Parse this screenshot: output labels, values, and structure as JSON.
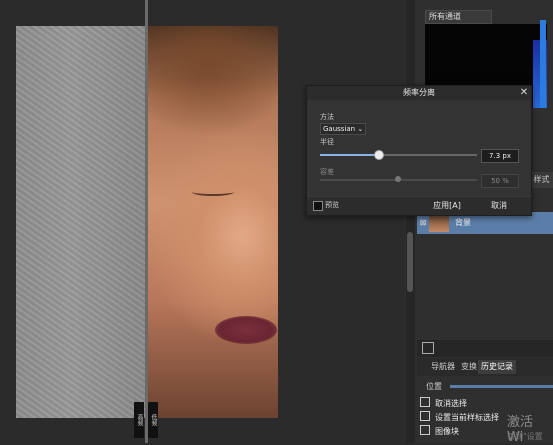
{
  "canvas": {
    "label_high_pass": "高频",
    "label_low_pass": "低频"
  },
  "histogram_panel": {
    "channel_dropdown": "所有通道"
  },
  "style_tab": "样式",
  "layers": {
    "items": [
      {
        "name": "背景"
      }
    ]
  },
  "bottom_panel": {
    "tabs": [
      "导航器",
      "变换",
      "历史记录"
    ],
    "active_tab": "历史记录",
    "position_label": "位置",
    "history_items": [
      "取消选择",
      "设置当前样标选择",
      "图像块"
    ]
  },
  "watermark": {
    "line1": "激活 Wi",
    "line2": "转到\"设置"
  },
  "dialog": {
    "title": "频率分离",
    "close_glyph": "✕",
    "method_label": "方法",
    "method_value": "Gaussian",
    "radius_label": "半径",
    "radius_value": "7.3 px",
    "tolerance_label": "容差",
    "tolerance_value": "50 %",
    "preview_label": "预览",
    "apply_label": "应用[A]",
    "cancel_label": "取消"
  }
}
